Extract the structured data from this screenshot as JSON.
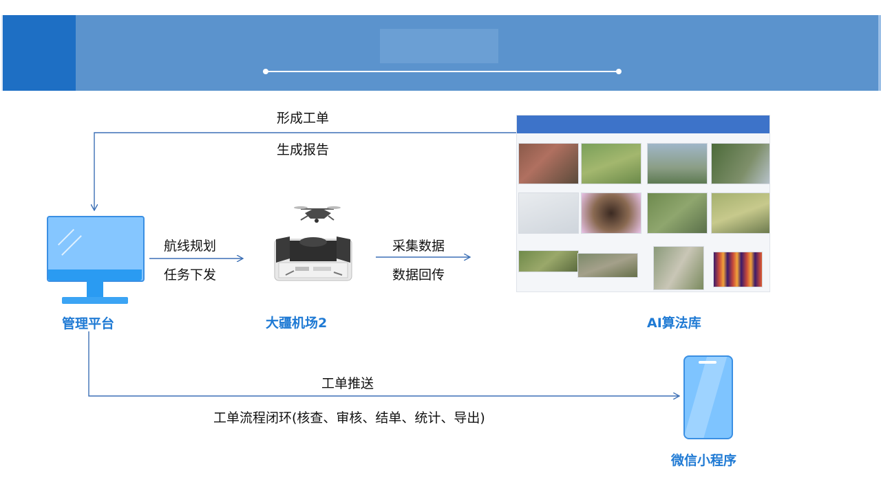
{
  "flow": {
    "top_return": {
      "line1": "形成工单",
      "line2": "生成报告"
    },
    "plan_to_dock": {
      "line1": "航线规划",
      "line2": "任务下发"
    },
    "dock_to_ai": {
      "line1": "采集数据",
      "line2": "数据回传"
    },
    "push": {
      "line1": "工单推送",
      "line2": "工单流程闭环(核查、审核、结单、统计、导出)"
    }
  },
  "nodes": {
    "platform": "管理平台",
    "dock": "大疆机场2",
    "ai_library": "AI算法库",
    "mini_program": "微信小程序"
  },
  "icons": {
    "platform": "monitor-icon",
    "dock": "drone-dock-icon",
    "mini_program": "smartphone-icon"
  },
  "colors": {
    "banner": "#5b93cd",
    "banner_accent": "#1e6fc4",
    "node_label": "#1f7ad4",
    "arrow": "#3b6fb5",
    "device_fill": "#85c6ff",
    "device_accent": "#2a9bf2"
  }
}
